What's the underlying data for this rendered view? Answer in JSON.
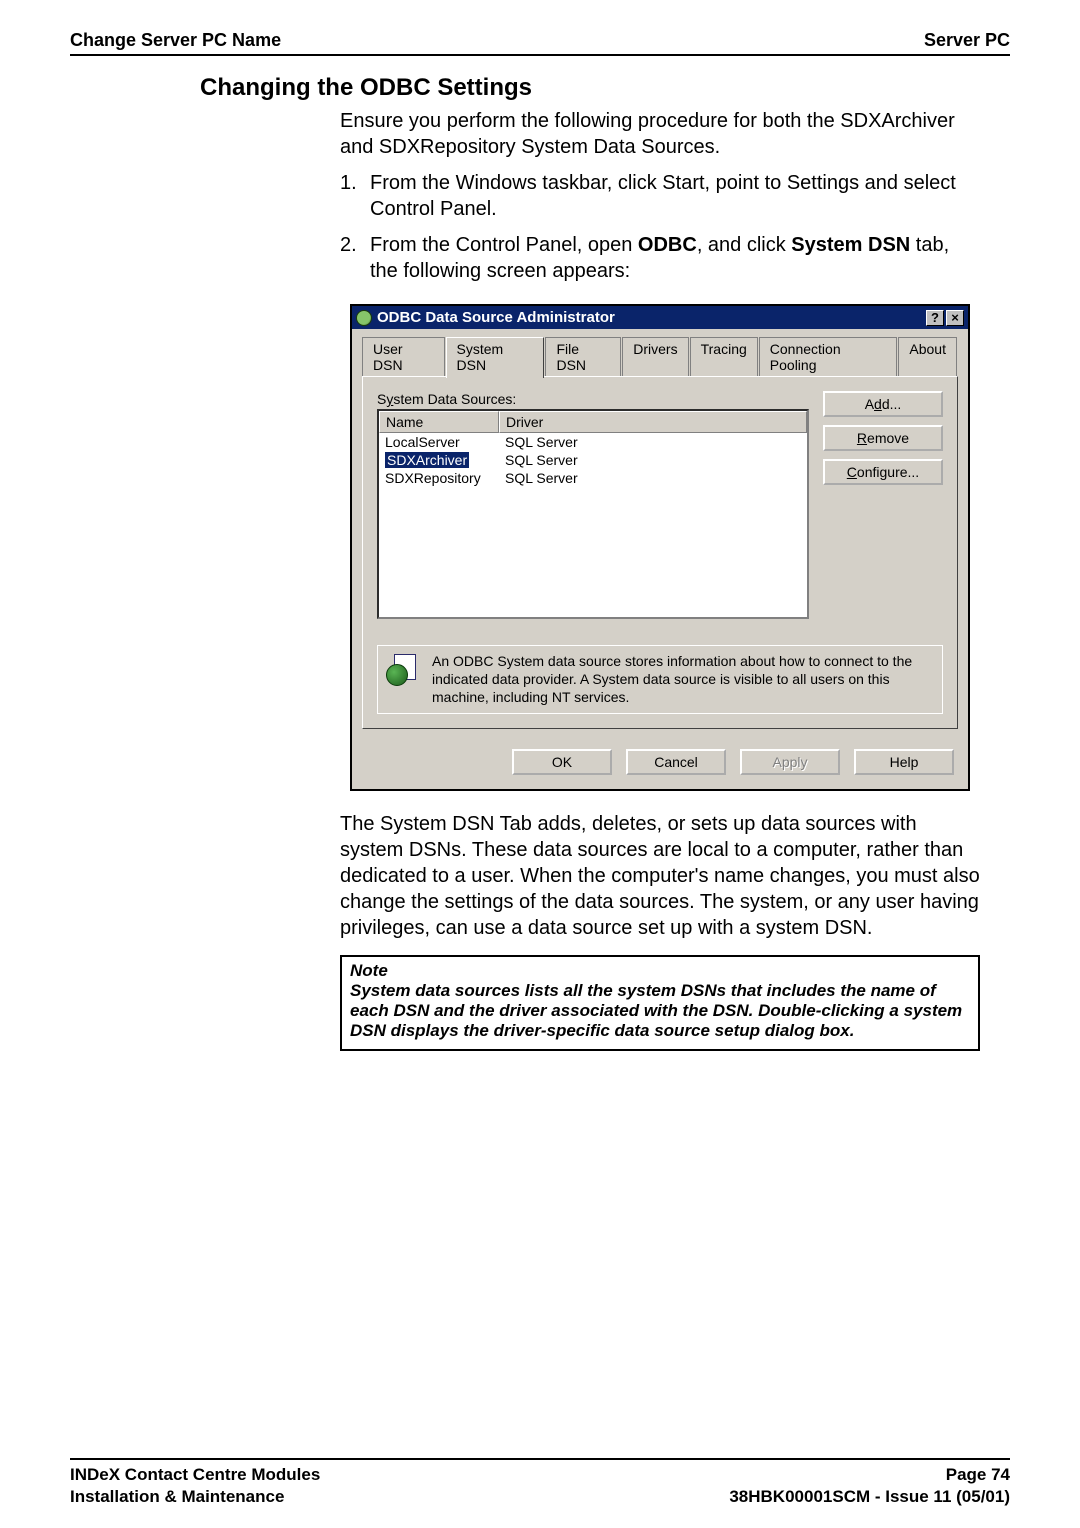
{
  "header": {
    "left": "Change Server PC Name",
    "right": "Server PC"
  },
  "section_title": "Changing the ODBC Settings",
  "intro": "Ensure you perform the following procedure for both the SDXArchiver and SDXRepository System Data Sources.",
  "steps": {
    "s1": "From the Windows taskbar, click Start, point to Settings and select Control Panel.",
    "s2_prefix": "From the Control Panel, open ",
    "s2_bold1": "ODBC",
    "s2_mid": ", and click ",
    "s2_bold2": "System DSN",
    "s2_suffix": " tab, the following screen appears:"
  },
  "dialog": {
    "title": "ODBC Data Source Administrator",
    "help_btn": "?",
    "close_btn": "×",
    "tabs": {
      "user": "User DSN",
      "system": "System DSN",
      "file": "File DSN",
      "drivers": "Drivers",
      "tracing": "Tracing",
      "pooling": "Connection Pooling",
      "about": "About"
    },
    "panel_label_pre": "S",
    "panel_label_u": "y",
    "panel_label_post": "stem Data Sources:",
    "columns": {
      "name": "Name",
      "driver": "Driver"
    },
    "rows": [
      {
        "name": "LocalServer",
        "driver": "SQL Server",
        "selected": false
      },
      {
        "name": "SDXArchiver",
        "driver": "SQL Server",
        "selected": true
      },
      {
        "name": "SDXRepository",
        "driver": "SQL Server",
        "selected": false
      }
    ],
    "buttons": {
      "add_pre": "A",
      "add_u": "d",
      "add_post": "d...",
      "remove_u": "R",
      "remove_post": "emove",
      "configure_u": "C",
      "configure_post": "onfigure..."
    },
    "info": "An ODBC System data source stores information about how to connect to the indicated data provider.   A System data source is visible to all users on this machine, including NT services.",
    "footer": {
      "ok": "OK",
      "cancel": "Cancel",
      "apply": "Apply",
      "help": "Help"
    }
  },
  "post_text": "The System DSN Tab adds, deletes, or sets up data sources with system DSNs.  These data sources are local to a computer, rather than dedicated to a user.  When the computer's name changes, you must also change the settings of the data sources.  The system, or any user having privileges, can use a data source set up with a system DSN.",
  "note": {
    "title": "Note",
    "body": "System data sources lists all the system DSNs that includes the name of each DSN and the driver associated with the DSN.  Double-clicking a system DSN displays the driver-specific data source setup dialog box."
  },
  "footer": {
    "left1": "INDeX Contact Centre Modules",
    "left2": "Installation & Maintenance",
    "right1": "Page 74",
    "right2": "38HBK00001SCM - Issue 11 (05/01)"
  }
}
